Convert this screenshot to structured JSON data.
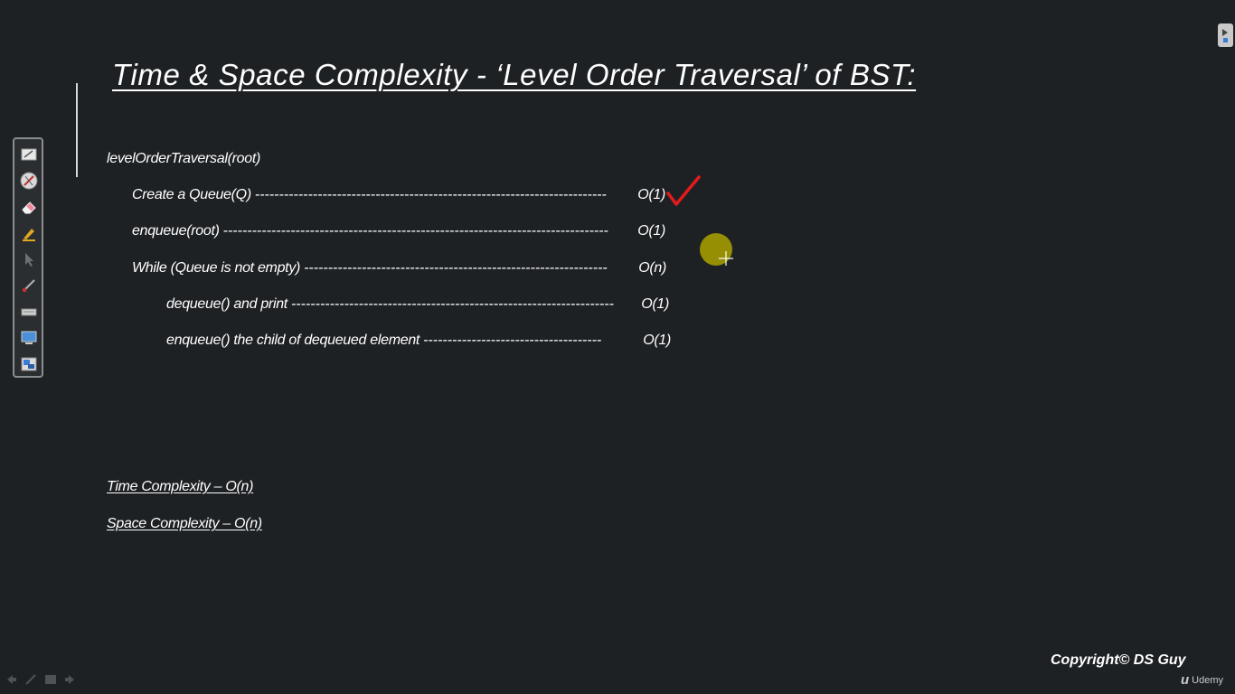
{
  "slide": {
    "title": "Time & Space Complexity - ‘Level Order Traversal’ of BST:",
    "function_name": "levelOrderTraversal(root)",
    "steps": [
      {
        "text": "Create a Queue(Q)",
        "dashes": "-------------------------------------------------------------------------",
        "complexity": "O(1)"
      },
      {
        "text": "enqueue(root)",
        "dashes": "--------------------------------------------------------------------------------",
        "complexity": "O(1)"
      },
      {
        "text": "While (Queue is not empty)",
        "dashes": "---------------------------------------------------------------",
        "complexity": "O(n)"
      },
      {
        "text": "dequeue() and print",
        "dashes": "-------------------------------------------------------------------",
        "complexity": "O(1)"
      },
      {
        "text": "enqueue() the child of dequeued element",
        "dashes": "-------------------------------------",
        "complexity": "O(1)"
      }
    ],
    "time_complexity": "Time Complexity – O(n)",
    "space_complexity": "Space Complexity – O(n)"
  },
  "footer": {
    "copyright": "Copyright© DS Guy",
    "brand": "Udemy"
  },
  "colors": {
    "background": "#1e2124",
    "text": "#ffffff",
    "check_mark": "#e31b1b",
    "pointer_highlight": "#a39a00"
  },
  "toolbar_icons": [
    "whiteboard-icon",
    "pen-off-icon",
    "eraser-icon",
    "highlighter-icon",
    "arrow-pointer-icon",
    "brush-icon",
    "keyboard-icon",
    "screen-icon",
    "switch-screen-icon"
  ]
}
